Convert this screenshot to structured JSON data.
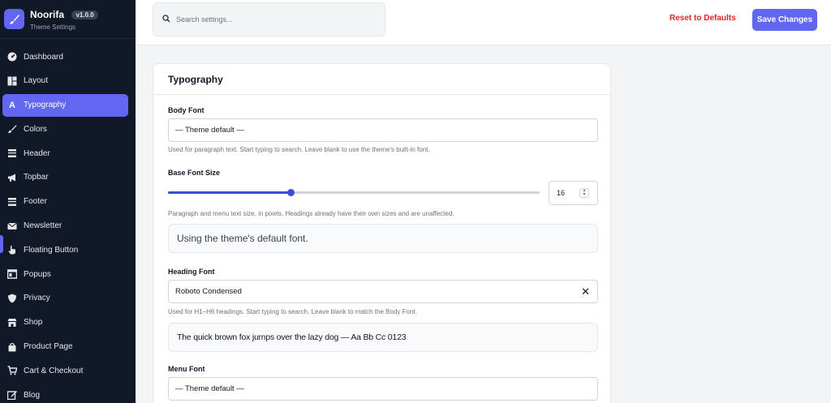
{
  "brand": {
    "name": "Noorifa",
    "version": "v1.0.0",
    "subtitle": "Theme Settings",
    "accent": "#6366f1"
  },
  "sidebar": {
    "items": [
      {
        "label": "Dashboard",
        "icon": "dashboard-icon"
      },
      {
        "label": "Layout",
        "icon": "layout-icon"
      },
      {
        "label": "Typography",
        "icon": "typography-icon",
        "active": true
      },
      {
        "label": "Colors",
        "icon": "paintbrush-icon"
      },
      {
        "label": "Header",
        "icon": "header-icon"
      },
      {
        "label": "Topbar",
        "icon": "megaphone-icon"
      },
      {
        "label": "Footer",
        "icon": "footer-icon"
      },
      {
        "label": "Newsletter",
        "icon": "envelope-icon"
      },
      {
        "label": "Floating Button",
        "icon": "hand-pointer-icon"
      },
      {
        "label": "Popups",
        "icon": "window-icon"
      },
      {
        "label": "Privacy",
        "icon": "shield-icon"
      },
      {
        "label": "Shop",
        "icon": "store-icon"
      },
      {
        "label": "Product Page",
        "icon": "bag-icon"
      },
      {
        "label": "Cart & Checkout",
        "icon": "cart-icon"
      },
      {
        "label": "Blog",
        "icon": "edit-icon"
      }
    ]
  },
  "topbar": {
    "search_placeholder": "Search settings...",
    "reset_label": "Reset to Defaults",
    "save_label": "Save Changes"
  },
  "section": {
    "title": "Typography",
    "body_font": {
      "label": "Body Font",
      "value": "— Theme default —",
      "help": "Used for paragraph text. Start typing to search. Leave blank to use the theme's built-in font."
    },
    "base_font_size": {
      "label": "Base Font Size",
      "value": "16",
      "slider_fraction": 0.33,
      "help": "Paragraph and menu text size, in pixels. Headings already have their own sizes and are unaffected.",
      "preview": "Using the theme's default font."
    },
    "heading_font": {
      "label": "Heading Font",
      "value": "Roboto Condensed",
      "clear": "✕",
      "help": "Used for H1–H6 headings. Start typing to search. Leave blank to match the Body Font.",
      "preview": "The quick brown fox jumps over the lazy dog — Aa Bb Cc 0123"
    },
    "menu_font": {
      "label": "Menu Font",
      "value": "— Theme default —"
    }
  }
}
